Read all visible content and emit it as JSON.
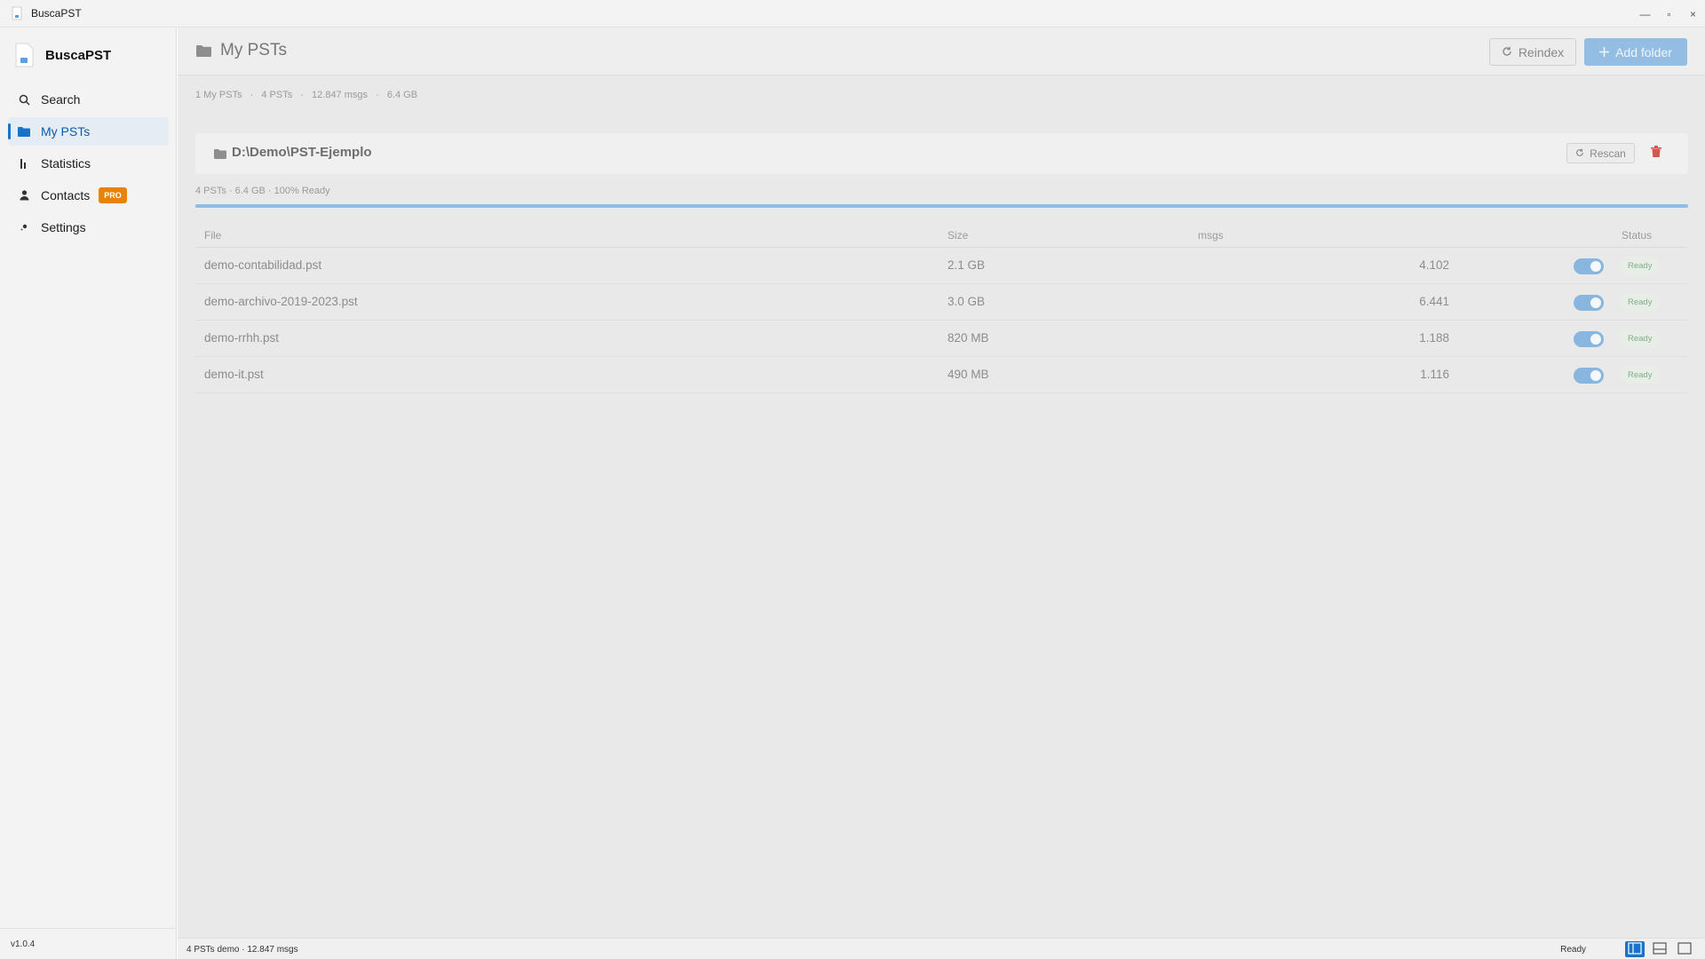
{
  "window": {
    "title": "BuscaPST",
    "controls": {
      "minimize": "—",
      "maximize": "▫",
      "close": "×"
    }
  },
  "sidebar": {
    "brand": "BuscaPST",
    "items": [
      {
        "label": "Search",
        "icon": "search-icon",
        "active": false
      },
      {
        "label": "My PSTs",
        "icon": "folder-icon",
        "active": true
      },
      {
        "label": "Statistics",
        "icon": "bar-chart-icon",
        "active": false
      },
      {
        "label": "Contacts",
        "icon": "person-icon",
        "active": false,
        "badge": "PRO"
      },
      {
        "label": "Settings",
        "icon": "gear-icon",
        "active": false
      }
    ],
    "version": "v1.0.4"
  },
  "header": {
    "title": "My PSTs",
    "reindex_label": "Reindex",
    "add_folder_label": "Add folder"
  },
  "summary": {
    "folders": "1 My PSTs",
    "psts": "4 PSTs",
    "msgs": "12.847 msgs",
    "size": "6.4 GB",
    "separator": "·"
  },
  "folder": {
    "path": "D:\\Demo\\PST-Ejemplo",
    "rescan_label": "Rescan",
    "status": "4 PSTs · 6.4 GB · 100% Ready",
    "progress": 1.0
  },
  "table": {
    "columns": {
      "file": "File",
      "size": "Size",
      "msgs": "msgs",
      "status": "Status"
    },
    "rows": [
      {
        "file": "demo-contabilidad.pst",
        "size": "2.1 GB",
        "msgs": "4.102",
        "enabled": true,
        "status": "Ready"
      },
      {
        "file": "demo-archivo-2019-2023.pst",
        "size": "3.0 GB",
        "msgs": "6.441",
        "enabled": true,
        "status": "Ready"
      },
      {
        "file": "demo-rrhh.pst",
        "size": "820 MB",
        "msgs": "1.188",
        "enabled": true,
        "status": "Ready"
      },
      {
        "file": "demo-it.pst",
        "size": "490 MB",
        "msgs": "1.116",
        "enabled": true,
        "status": "Ready"
      }
    ]
  },
  "statusbar": {
    "left": "4 PSTs demo · 12.847 msgs",
    "right": "Ready"
  },
  "colors": {
    "accent": "#1a73c9",
    "pro_badge": "#e8820c",
    "delete": "#d9534f",
    "ready": "#7fb084"
  }
}
